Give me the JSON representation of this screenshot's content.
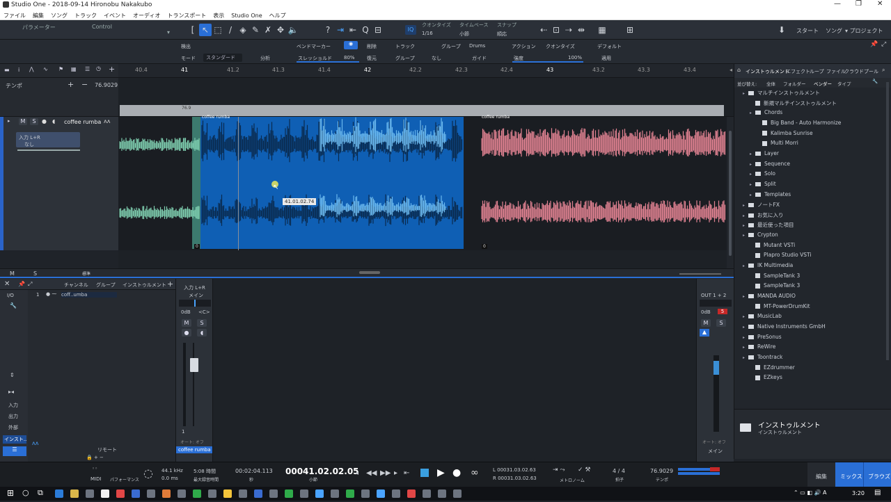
{
  "window": {
    "title": "Studio One - 2018-09-14 Hironobu Nakakubo"
  },
  "menu": [
    "ファイル",
    "編集",
    "ソング",
    "トラック",
    "イベント",
    "オーディオ",
    "トランスポート",
    "表示",
    "Studio One",
    "ヘルプ"
  ],
  "toolbar": {
    "param_label": "パラメーター",
    "control_label": "Control",
    "quantize_label": "クオンタイズ",
    "quantize_value": "1/16",
    "timebase_label": "タイムベース",
    "timebase_value": "小節",
    "snap_label": "スナップ",
    "snap_value": "順応",
    "start": "スタート",
    "song": "ソング",
    "project": "プロジェクト"
  },
  "infobar": {
    "detect": "検出",
    "mode": "モード",
    "mode_value": "スタンダード",
    "analyze": "分析",
    "bend_marker": "ベンドマーカー",
    "threshold": "スレッショルド",
    "threshold_value": "80%",
    "remove": "削除",
    "restore": "復元",
    "track": "トラック",
    "group": "グループ",
    "group_value": "Drums",
    "group2": "グループ",
    "none": "なし",
    "guide": "ガイド",
    "action": "アクション",
    "quantize": "クオンタイズ",
    "strength": "強度",
    "strength_value": "100%",
    "default": "デフォルト",
    "apply": "適用"
  },
  "ruler": [
    "40.4",
    "41",
    "41.2",
    "41.3",
    "41.4",
    "42",
    "42.2",
    "42.3",
    "42.4",
    "43",
    "43.2",
    "43.3",
    "43.4"
  ],
  "tempo": {
    "label": "テンポ",
    "value": "76.9029",
    "lane_value": "76.9"
  },
  "track": {
    "name": "coffee rumba",
    "input": "入力 L+R",
    "output": "なし",
    "m": "M",
    "s": "S"
  },
  "events": {
    "name": "coffee rumba",
    "tooltip": "41.01.02.74",
    "start0": "0",
    "start1": "0"
  },
  "arr_bottom": {
    "m": "M",
    "s": "S",
    "std": "標準"
  },
  "browser": {
    "tabs": [
      "インストゥルメント",
      "エフェクト",
      "ループ",
      "ファイル",
      "クラウド",
      "プール"
    ],
    "sort_label": "並び替え:",
    "sort_opts": [
      "全体",
      "フォルダー",
      "ベンダー",
      "タイプ"
    ],
    "items": [
      {
        "label": "マルチインストゥルメント",
        "level": 1,
        "type": "folder"
      },
      {
        "label": "新規マルチインストゥルメント",
        "level": 2,
        "type": "item"
      },
      {
        "label": "Chords",
        "level": 2,
        "type": "folder"
      },
      {
        "label": "Big Band - Auto Harmonize",
        "level": 3,
        "type": "item"
      },
      {
        "label": "Kalimba Sunrise",
        "level": 3,
        "type": "item"
      },
      {
        "label": "Multi Morri",
        "level": 3,
        "type": "item"
      },
      {
        "label": "Layer",
        "level": 2,
        "type": "folder"
      },
      {
        "label": "Sequence",
        "level": 2,
        "type": "folder"
      },
      {
        "label": "Solo",
        "level": 2,
        "type": "folder"
      },
      {
        "label": "Split",
        "level": 2,
        "type": "folder"
      },
      {
        "label": "Templates",
        "level": 2,
        "type": "folder"
      },
      {
        "label": "ノートFX",
        "level": 1,
        "type": "folder"
      },
      {
        "label": "お気に入り",
        "level": 1,
        "type": "folder"
      },
      {
        "label": "最近使った項目",
        "level": 1,
        "type": "folder"
      },
      {
        "label": "Crypton",
        "level": 1,
        "type": "folder"
      },
      {
        "label": "Mutant VSTi",
        "level": 2,
        "type": "item"
      },
      {
        "label": "Plapro Studio VSTi",
        "level": 2,
        "type": "item"
      },
      {
        "label": "IK Multimedia",
        "level": 1,
        "type": "folder"
      },
      {
        "label": "SampleTank 3",
        "level": 2,
        "type": "item"
      },
      {
        "label": "SampleTank 3",
        "level": 2,
        "type": "item"
      },
      {
        "label": "MANDA AUDIO",
        "level": 1,
        "type": "folder"
      },
      {
        "label": "MT-PowerDrumKit",
        "level": 2,
        "type": "item"
      },
      {
        "label": "MusicLab",
        "level": 1,
        "type": "folder"
      },
      {
        "label": "Native Instruments GmbH",
        "level": 1,
        "type": "folder"
      },
      {
        "label": "PreSonus",
        "level": 1,
        "type": "folder"
      },
      {
        "label": "ReWire",
        "level": 1,
        "type": "folder"
      },
      {
        "label": "Toontrack",
        "level": 1,
        "type": "folder"
      },
      {
        "label": "EZdrummer",
        "level": 2,
        "type": "item"
      },
      {
        "label": "EZkeys",
        "level": 2,
        "type": "item"
      }
    ],
    "footer_title": "インストゥルメント",
    "footer_sub": "インストゥルメント"
  },
  "console": {
    "headers": [
      "チャンネル",
      "グループ",
      "インストゥルメント"
    ],
    "io": "I/O",
    "row_num": "1",
    "row_name": "coff..umba",
    "side": [
      "入力",
      "出力",
      "外部",
      "インスト..."
    ],
    "remote": "リモート",
    "ch_input": "入力 L+R",
    "ch_main": "メイン",
    "ch_db": "0dB",
    "ch_pan": "<C>",
    "ch_num": "1",
    "ch_auto": "オート: オフ",
    "ch_name": "coffee rumba",
    "main_out": "OUT 1 + 2",
    "main_db": "0dB",
    "main_clip": "5",
    "main_auto": "オート: オフ",
    "main_name": "メイン"
  },
  "transport": {
    "midi": "MIDI",
    "perf": "パフォーマンス",
    "rate": "44.1 kHz",
    "latency": "0.0 ms",
    "rec_time": "5:08 時間",
    "rec_label": "最大録音時間",
    "time": "00:02:04.113",
    "time_label": "秒",
    "position": "00041.02.02.05",
    "pos_label": "小節",
    "L": "00031.03.02.63",
    "R": "00031.03.02.63",
    "metro": "メトロノーム",
    "sig": "4 / 4",
    "sig_label": "拍子",
    "tempo": "76.9029",
    "tempo_label": "テンポ",
    "edit": "編集",
    "mix": "ミックス",
    "browse": "ブラウズ"
  },
  "taskbar": {
    "time": "3:20"
  }
}
